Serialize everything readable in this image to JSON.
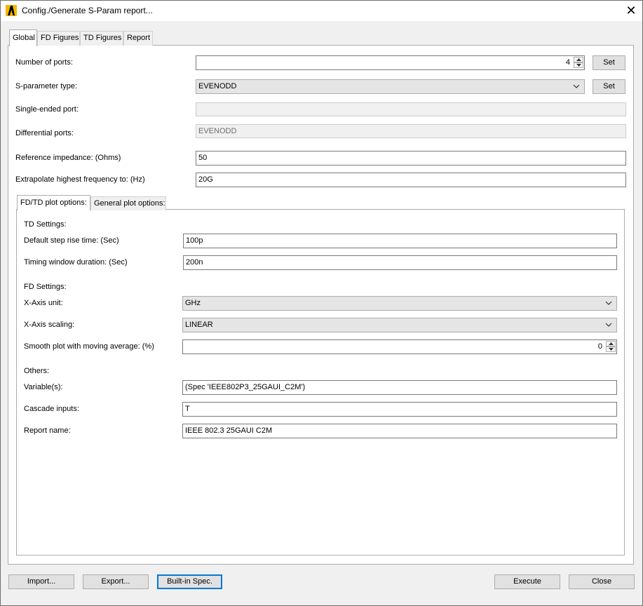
{
  "window": {
    "title": "Config./Generate S-Param report...",
    "app_icon": "app-logo-icon",
    "close_glyph": "✕"
  },
  "tabs": [
    "Global",
    "FD Figures",
    "TD Figures",
    "Report"
  ],
  "global": {
    "num_ports": {
      "label": "Number of ports:",
      "value": "4",
      "set_label": "Set"
    },
    "sparam_type": {
      "label": "S-parameter type:",
      "value": "EVENODD",
      "set_label": "Set"
    },
    "single_ended": {
      "label": "Single-ended port:",
      "value": ""
    },
    "differential": {
      "label": "Differential ports:",
      "value": "EVENODD"
    },
    "ref_impedance": {
      "label": "Reference impedance: (Ohms)",
      "value": "50"
    },
    "extrapolate": {
      "label": "Extrapolate highest frequency to: (Hz)",
      "value": "20G"
    }
  },
  "inner_tabs": [
    "FD/TD plot options:",
    "General plot options:"
  ],
  "plot_options": {
    "td_header": "TD Settings:",
    "step_rise": {
      "label": "Default step rise time: (Sec)",
      "value": "100p"
    },
    "timing_window": {
      "label": "Timing window duration: (Sec)",
      "value": "200n"
    },
    "fd_header": "FD Settings:",
    "xaxis_unit": {
      "label": "X-Axis unit:",
      "value": "GHz"
    },
    "xaxis_scaling": {
      "label": "X-Axis scaling:",
      "value": "LINEAR"
    },
    "smooth": {
      "label": "Smooth plot with moving average: (%)",
      "value": "0"
    },
    "others_header": "Others:",
    "variables": {
      "label": "Variable(s):",
      "value": "(Spec 'IEEE802P3_25GAUI_C2M')"
    },
    "cascade": {
      "label": "Cascade inputs:",
      "value": "T"
    },
    "report_name": {
      "label": "Report name:",
      "value": "IEEE 802.3 25GAUI C2M"
    }
  },
  "buttons": {
    "import": "Import...",
    "export": "Export...",
    "builtin": "Built-in Spec.",
    "execute": "Execute",
    "close": "Close"
  },
  "colors": {
    "focus": "#0078d7",
    "logo_yellow": "#f5b800"
  }
}
